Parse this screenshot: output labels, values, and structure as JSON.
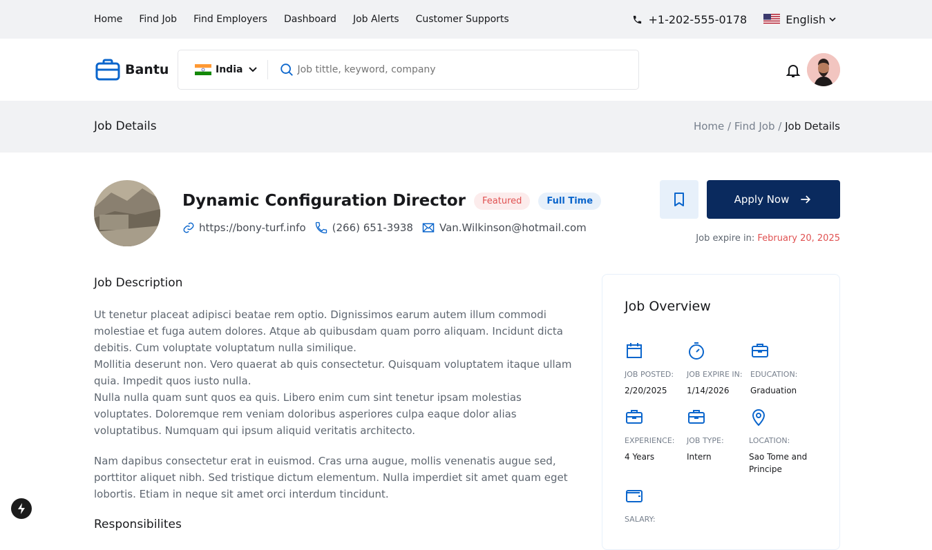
{
  "topnav": {
    "items": [
      "Home",
      "Find Job",
      "Find Employers",
      "Dashboard",
      "Job Alerts",
      "Customer Supports"
    ],
    "phone": "+1-202-555-0178",
    "language": "English"
  },
  "header": {
    "logo": "Bantu",
    "country": "India",
    "search_placeholder": "Job tittle, keyword, company"
  },
  "breadcrumb": {
    "page_title": "Job Details",
    "items": [
      "Home",
      "Find Job",
      "Job Details"
    ]
  },
  "job": {
    "title": "Dynamic Configuration Director",
    "badge_featured": "Featured",
    "badge_type": "Full Time",
    "website": "https://bony-turf.info",
    "phone": "(266) 651-3938",
    "email": "Van.Wilkinson@hotmail.com",
    "apply_label": "Apply Now",
    "expire_label": "Job expire in:",
    "expire_date": "February 20, 2025"
  },
  "description": {
    "title": "Job Description",
    "paragraph1_lines": [
      "Ut tenetur placeat adipisci beatae rem optio. Dignissimos earum autem illum commodi molestiae et fuga autem dolores. Atque ab quibusdam quam porro aliquam. Incidunt dicta debitis. Cum voluptate voluptatum nulla similique.",
      "Mollitia deserunt non. Vero quaerat ab quis consectetur. Quisquam voluptatem itaque ullam quia. Impedit quos iusto nulla.",
      "Nulla nulla quam sunt quos ea quis. Libero enim cum sint tenetur ipsam molestias voluptates. Doloremque rem veniam doloribus asperiores culpa eaque dolor alias voluptatibus. Numquam qui ipsum aliquid veritatis architecto."
    ],
    "paragraph2": "Nam dapibus consectetur erat in euismod. Cras urna augue, mollis venenatis augue sed, porttitor aliquet nibh. Sed tristique dictum elementum. Nulla imperdiet sit amet quam eget lobortis. Etiam in neque sit amet orci interdum tincidunt.",
    "responsibilities_title": "Responsibilites"
  },
  "overview": {
    "title": "Job Overview",
    "items": [
      {
        "icon": "calendar-icon",
        "label": "JOB POSTED:",
        "value": "2/20/2025"
      },
      {
        "icon": "timer-icon",
        "label": "JOB EXPIRE IN:",
        "value": "1/14/2026"
      },
      {
        "icon": "briefcase-icon",
        "label": "EDUCATION:",
        "value": "Graduation"
      },
      {
        "icon": "briefcase-icon",
        "label": "EXPERIENCE:",
        "value": "4 Years"
      },
      {
        "icon": "briefcase-icon",
        "label": "JOB TYPE:",
        "value": "Intern"
      },
      {
        "icon": "map-pin-icon",
        "label": "LOCATION:",
        "value": "Sao Tome and Principe"
      },
      {
        "icon": "wallet-icon",
        "label": "SALARY:",
        "value": ""
      }
    ]
  },
  "colors": {
    "primary": "#0a65cc",
    "apply_button": "#0a2a5e",
    "danger": "#e05151"
  }
}
